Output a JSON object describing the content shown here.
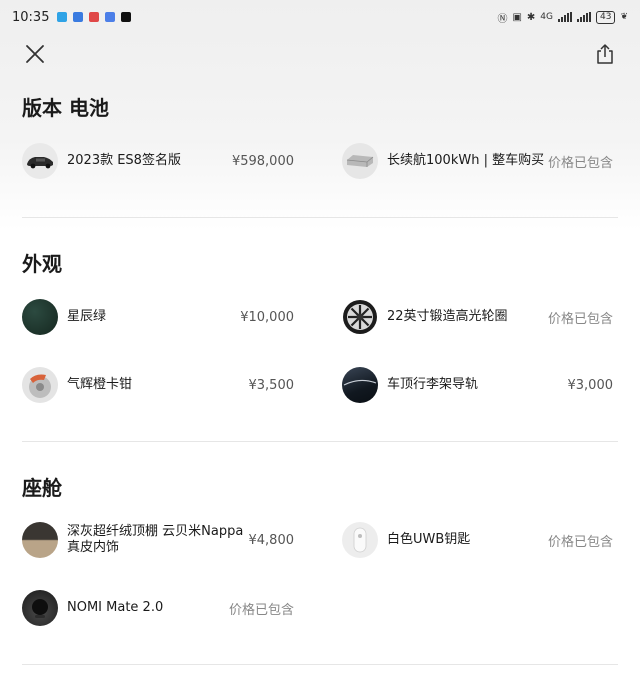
{
  "status_bar": {
    "time": "10:35",
    "network": "4G",
    "battery": "43"
  },
  "icons": {
    "close": "close-icon",
    "share": "share-icon"
  },
  "sections": [
    {
      "title": "版本 电池",
      "items": [
        {
          "name": "2023款 ES8签名版",
          "price": "¥598,000"
        },
        {
          "name": "长续航100kWh | 整车购买",
          "price": "价格已包含"
        }
      ]
    },
    {
      "title": "外观",
      "items": [
        {
          "name": "星辰绿",
          "price": "¥10,000"
        },
        {
          "name": "22英寸锻造高光轮圈",
          "price": "价格已包含"
        },
        {
          "name": "气辉橙卡钳",
          "price": "¥3,500"
        },
        {
          "name": "车顶行李架导轨",
          "price": "¥3,000"
        }
      ]
    },
    {
      "title": "座舱",
      "items": [
        {
          "name_line1": "深灰超纤绒顶棚 云贝米Nappa",
          "name_line2": "真皮内饰",
          "price": "¥4,800"
        },
        {
          "name": "白色UWB钥匙",
          "price": "价格已包含"
        },
        {
          "name": "NOMI Mate 2.0",
          "price": "价格已包含"
        }
      ]
    }
  ],
  "colors": {
    "star_green": "#1f3a32",
    "caliper_orange": "#d8623a",
    "cabin_dark": "#3a3632",
    "cabin_beige": "#b9a488"
  }
}
